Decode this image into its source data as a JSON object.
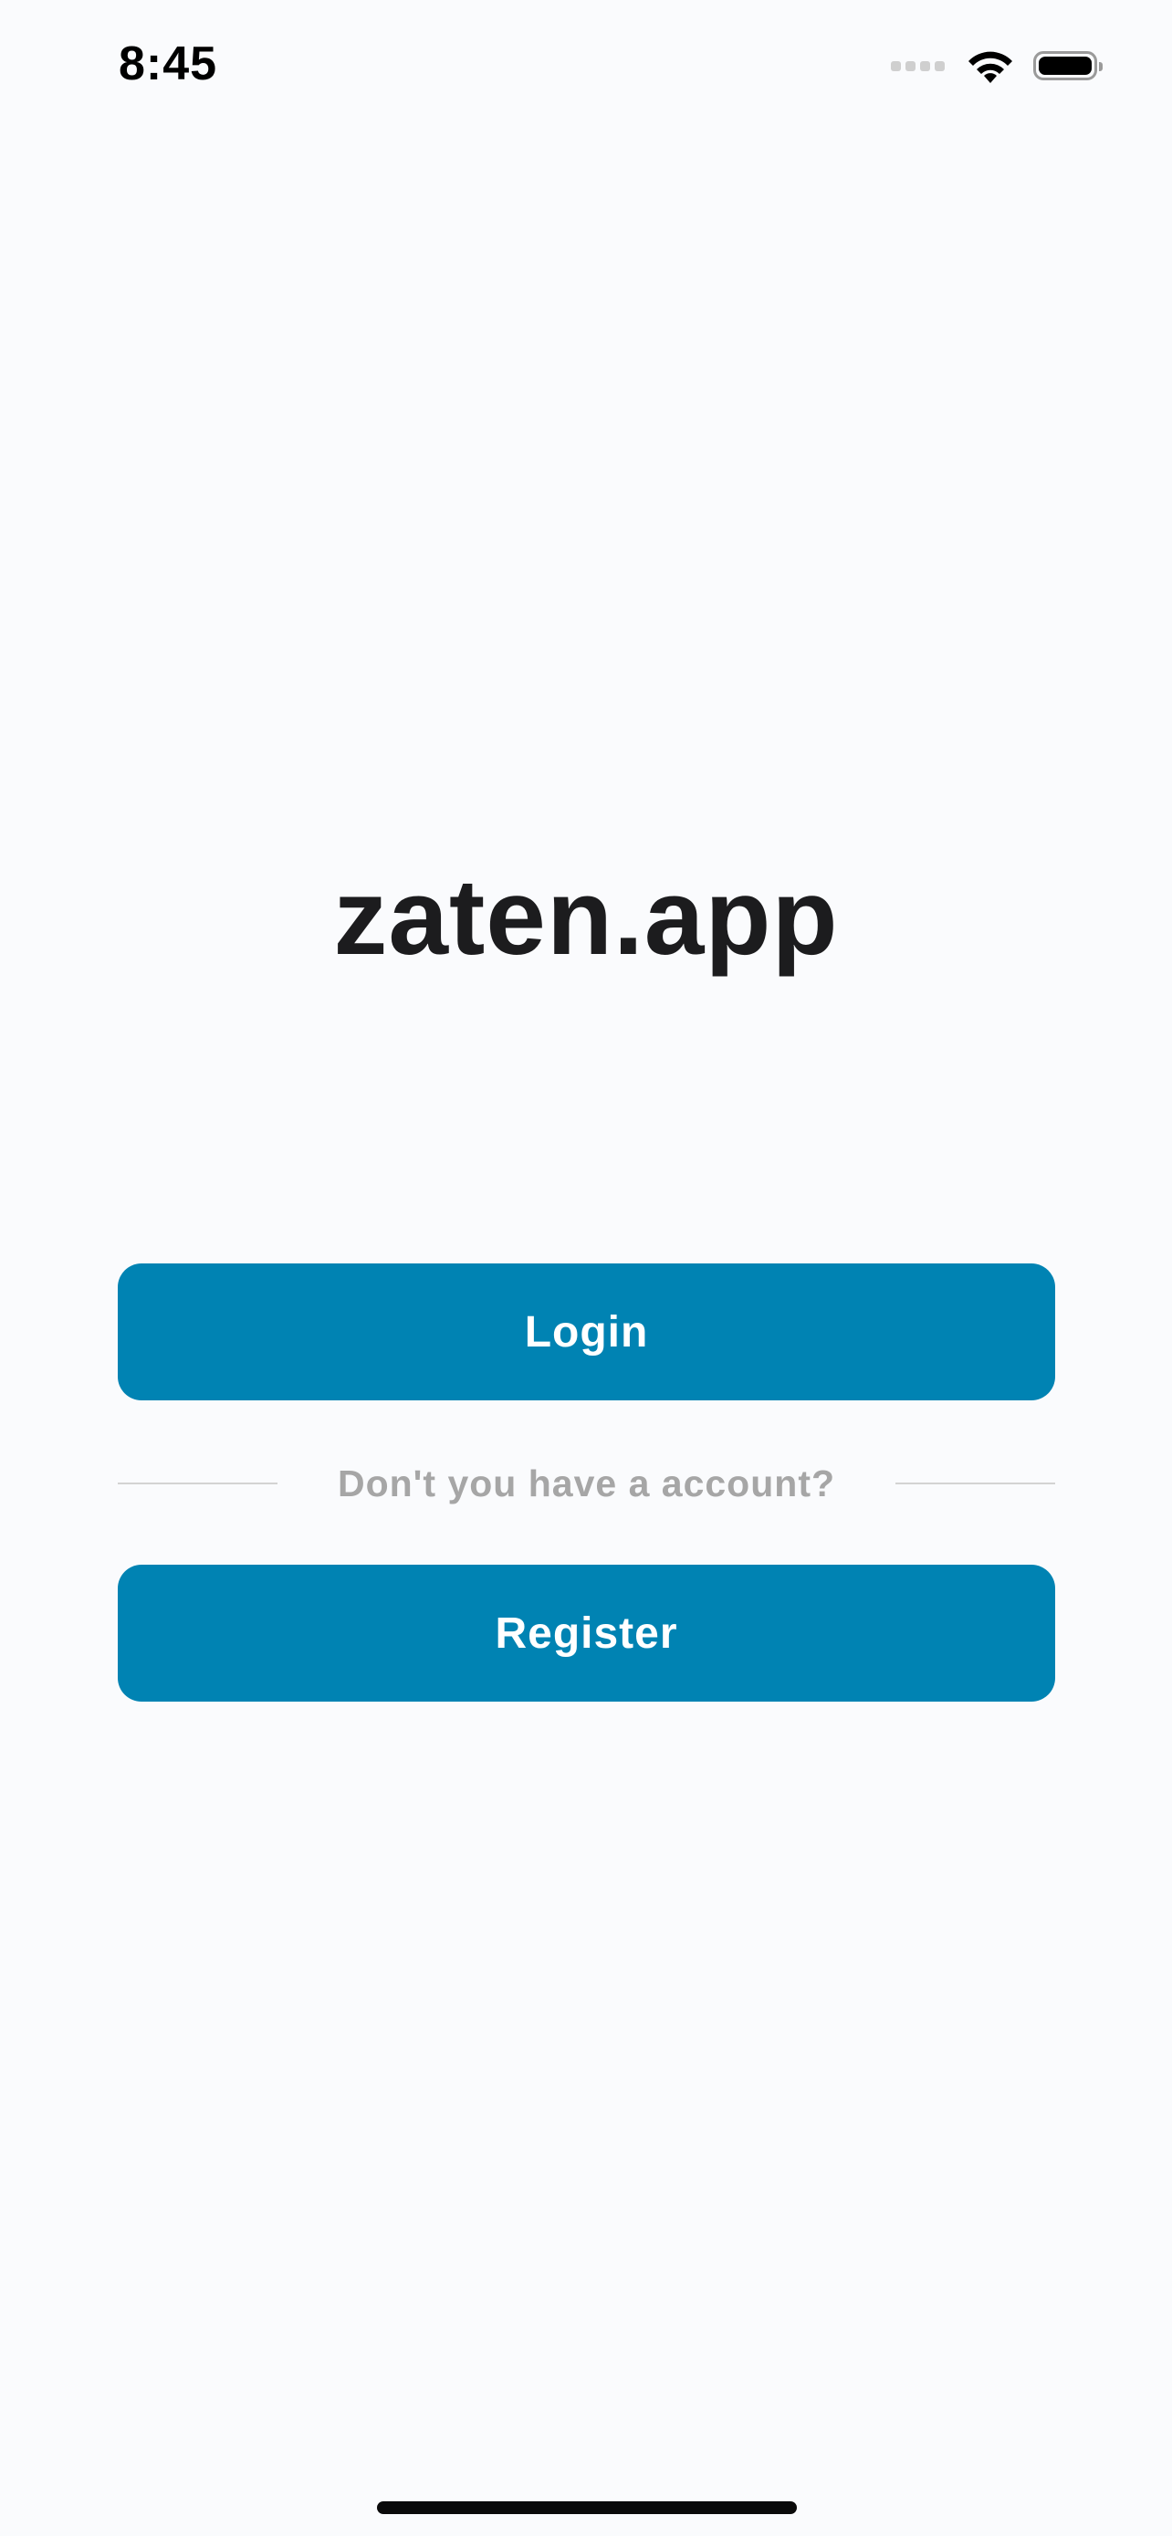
{
  "status_bar": {
    "time": "8:45",
    "icons": [
      "signal-icon",
      "wifi-icon",
      "battery-icon"
    ],
    "battery_level": 1.0
  },
  "app": {
    "logo_text": "zaten.app"
  },
  "actions": {
    "login_label": "Login",
    "divider_text": "Don't you have a account?",
    "register_label": "Register"
  },
  "colors": {
    "background": "#fafbfd",
    "primary": "#0083b3",
    "title": "#1c1c1e",
    "muted_text": "#a6a6a6",
    "divider": "#d3d3d3"
  }
}
